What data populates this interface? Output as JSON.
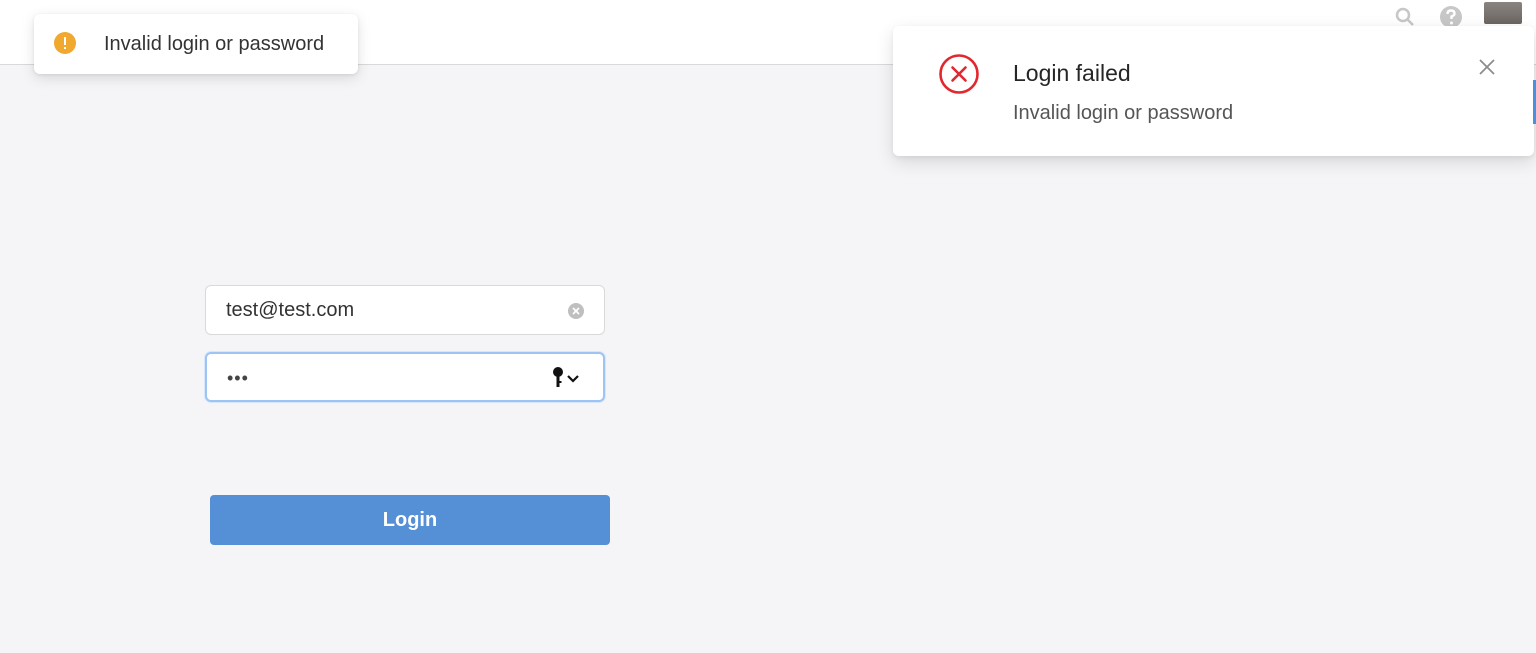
{
  "toast": {
    "text": "Invalid login or password",
    "icon": "warning-icon",
    "icon_color": "#f0a92e"
  },
  "notification": {
    "title": "Login failed",
    "description": "Invalid login or password",
    "icon": "error-circle-icon",
    "icon_color": "#e0282e",
    "close_icon": "close-icon"
  },
  "header": {
    "icons": [
      "search-icon",
      "help-icon",
      "avatar"
    ]
  },
  "form": {
    "email": {
      "value": "test@test.com",
      "clear_icon": "clear-circle-icon"
    },
    "password": {
      "masked_value": "•••",
      "key_icon": "key-dropdown-icon"
    },
    "submit_label": "Login",
    "submit_color": "#5590d6"
  }
}
